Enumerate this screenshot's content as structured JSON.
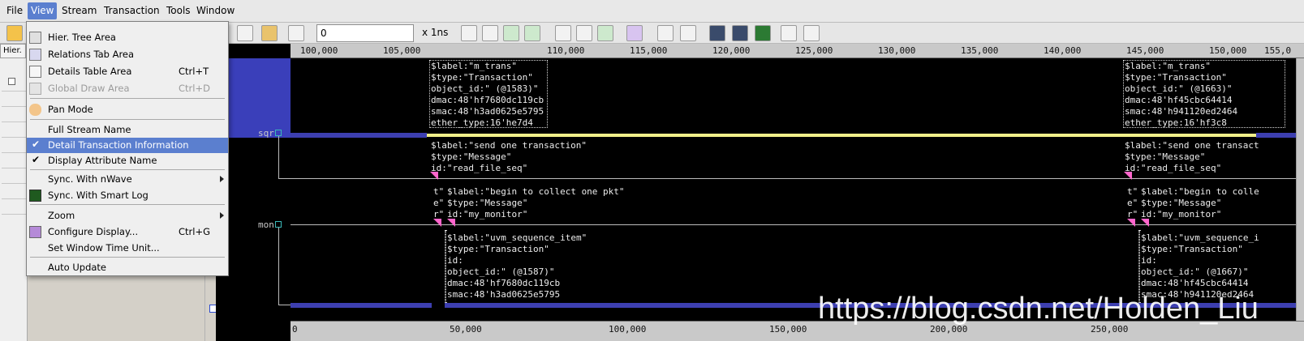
{
  "menubar": {
    "items": [
      {
        "label": "File"
      },
      {
        "label": "View"
      },
      {
        "label": "Stream"
      },
      {
        "label": "Transaction"
      },
      {
        "label": "Tools"
      },
      {
        "label": "Window"
      }
    ]
  },
  "toolbar": {
    "time_value": "0",
    "time_unit": "x 1ns",
    "icons": [
      "open-folder-icon",
      "cursor-icon",
      "signal-icon",
      "search-icon",
      "zoom-100-icon",
      "zoom-out-icon",
      "zoom-in-icon",
      "zoom-fit-icon",
      "zoom-prev-icon",
      "zoom-next-icon",
      "marker-icon",
      "prev-arrow-icon",
      "next-arrow-icon",
      "waveform-icon",
      "chip-icon",
      "chip-green-icon",
      "bookmark-icon",
      "settings-icon"
    ]
  },
  "left_pane": {
    "tab_label": "Hier."
  },
  "view_menu": {
    "items": [
      {
        "label": "Hier. Tree Area",
        "accel": "",
        "icon": "tree-icon"
      },
      {
        "label": "Relations Tab Area",
        "accel": "",
        "icon": "relations-icon"
      },
      {
        "label": "Details Table Area",
        "accel": "Ctrl+T",
        "icon": "table-icon"
      },
      {
        "label": "Global Draw Area",
        "accel": "Ctrl+D",
        "icon": "draw-icon",
        "disabled": true
      },
      {
        "label": "Pan Mode",
        "accel": "",
        "icon": "hand-icon"
      },
      {
        "label": "Full Stream Name",
        "accel": ""
      },
      {
        "label": "Detail Transaction Information",
        "accel": "",
        "checked": true,
        "highlighted": true
      },
      {
        "label": "Display Attribute Name",
        "accel": "",
        "checked": true
      },
      {
        "label": "Sync. With nWave",
        "accel": "",
        "submenu": true
      },
      {
        "label": "Sync. With Smart Log",
        "accel": "",
        "icon": "log-icon"
      },
      {
        "label": "Zoom",
        "accel": "",
        "submenu": true
      },
      {
        "label": "Configure Display...",
        "accel": "Ctrl+G",
        "icon": "configure-icon"
      },
      {
        "label": "Set Window Time Unit...",
        "accel": ""
      },
      {
        "label": "Auto Update",
        "accel": ""
      }
    ]
  },
  "signals": {
    "sqr": "sqr",
    "mon": "mon"
  },
  "ruler_top": [
    "100,000",
    "105,000",
    "110,000",
    "115,000",
    "120,000",
    "125,000",
    "130,000",
    "135,000",
    "140,000",
    "145,000",
    "150,000",
    "155,0"
  ],
  "ruler_bottom": [
    "0",
    "50,000",
    "100,000",
    "150,000",
    "200,000",
    "250,000"
  ],
  "transactions": {
    "t1": "$label:\"m_trans\"\n$type:\"Transaction\"\nobject_id:\" (@1583)\"\ndmac:48'hf7680dc119cb\nsmac:48'h3ad0625e5795\nether_type:16'he7d4",
    "t2": "$label:\"m_trans\"\n$type:\"Transaction\"\nobject_id:\" (@1663)\"\ndmac:48'hf45cbc64414\nsmac:48'h941120ed2464\nether_type:16'hf3c8",
    "m1": "$label:\"send one transaction\"\n$type:\"Message\"\nid:\"read_file_seq\"",
    "m2": "$label:\"send one transact\n$type:\"Message\"\nid:\"read_file_seq\"",
    "m3": "$label:\"begin to collect one pkt\"\n$type:\"Message\"\nid:\"my_monitor\"",
    "m3s": "t\"\ne\"\nr\"",
    "m4": "$label:\"begin to colle\n$type:\"Message\"\nid:\"my_monitor\"",
    "m4s": "t\"\ne\"\nr\"",
    "t3": "$label:\"uvm_sequence_item\"\n$type:\"Transaction\"\nid:\nobject_id:\" (@1587)\"\ndmac:48'hf7680dc119cb\nsmac:48'h3ad0625e5795",
    "t4": "$label:\"uvm_sequence_i\n$type:\"Transaction\"\nid:\nobject_id:\" (@1667)\"\ndmac:48'hf45cbc64414\nsmac:48'h941120ed2464"
  },
  "watermark": "https://blog.csdn.net/Holden_Liu"
}
